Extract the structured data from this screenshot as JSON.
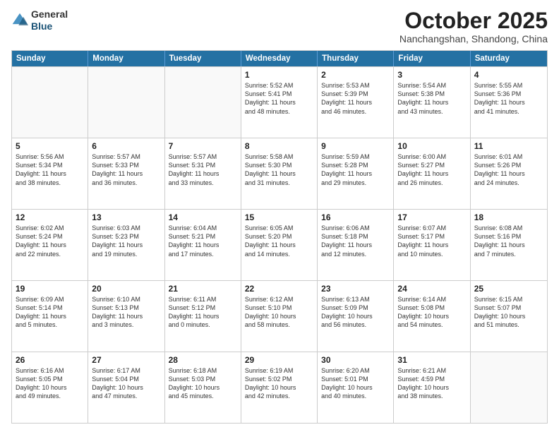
{
  "logo": {
    "general": "General",
    "blue": "Blue"
  },
  "header": {
    "month": "October 2025",
    "location": "Nanchangshan, Shandong, China"
  },
  "days": [
    "Sunday",
    "Monday",
    "Tuesday",
    "Wednesday",
    "Thursday",
    "Friday",
    "Saturday"
  ],
  "weeks": [
    [
      {
        "date": "",
        "info": ""
      },
      {
        "date": "",
        "info": ""
      },
      {
        "date": "",
        "info": ""
      },
      {
        "date": "1",
        "info": "Sunrise: 5:52 AM\nSunset: 5:41 PM\nDaylight: 11 hours\nand 48 minutes."
      },
      {
        "date": "2",
        "info": "Sunrise: 5:53 AM\nSunset: 5:39 PM\nDaylight: 11 hours\nand 46 minutes."
      },
      {
        "date": "3",
        "info": "Sunrise: 5:54 AM\nSunset: 5:38 PM\nDaylight: 11 hours\nand 43 minutes."
      },
      {
        "date": "4",
        "info": "Sunrise: 5:55 AM\nSunset: 5:36 PM\nDaylight: 11 hours\nand 41 minutes."
      }
    ],
    [
      {
        "date": "5",
        "info": "Sunrise: 5:56 AM\nSunset: 5:34 PM\nDaylight: 11 hours\nand 38 minutes."
      },
      {
        "date": "6",
        "info": "Sunrise: 5:57 AM\nSunset: 5:33 PM\nDaylight: 11 hours\nand 36 minutes."
      },
      {
        "date": "7",
        "info": "Sunrise: 5:57 AM\nSunset: 5:31 PM\nDaylight: 11 hours\nand 33 minutes."
      },
      {
        "date": "8",
        "info": "Sunrise: 5:58 AM\nSunset: 5:30 PM\nDaylight: 11 hours\nand 31 minutes."
      },
      {
        "date": "9",
        "info": "Sunrise: 5:59 AM\nSunset: 5:28 PM\nDaylight: 11 hours\nand 29 minutes."
      },
      {
        "date": "10",
        "info": "Sunrise: 6:00 AM\nSunset: 5:27 PM\nDaylight: 11 hours\nand 26 minutes."
      },
      {
        "date": "11",
        "info": "Sunrise: 6:01 AM\nSunset: 5:26 PM\nDaylight: 11 hours\nand 24 minutes."
      }
    ],
    [
      {
        "date": "12",
        "info": "Sunrise: 6:02 AM\nSunset: 5:24 PM\nDaylight: 11 hours\nand 22 minutes."
      },
      {
        "date": "13",
        "info": "Sunrise: 6:03 AM\nSunset: 5:23 PM\nDaylight: 11 hours\nand 19 minutes."
      },
      {
        "date": "14",
        "info": "Sunrise: 6:04 AM\nSunset: 5:21 PM\nDaylight: 11 hours\nand 17 minutes."
      },
      {
        "date": "15",
        "info": "Sunrise: 6:05 AM\nSunset: 5:20 PM\nDaylight: 11 hours\nand 14 minutes."
      },
      {
        "date": "16",
        "info": "Sunrise: 6:06 AM\nSunset: 5:18 PM\nDaylight: 11 hours\nand 12 minutes."
      },
      {
        "date": "17",
        "info": "Sunrise: 6:07 AM\nSunset: 5:17 PM\nDaylight: 11 hours\nand 10 minutes."
      },
      {
        "date": "18",
        "info": "Sunrise: 6:08 AM\nSunset: 5:16 PM\nDaylight: 11 hours\nand 7 minutes."
      }
    ],
    [
      {
        "date": "19",
        "info": "Sunrise: 6:09 AM\nSunset: 5:14 PM\nDaylight: 11 hours\nand 5 minutes."
      },
      {
        "date": "20",
        "info": "Sunrise: 6:10 AM\nSunset: 5:13 PM\nDaylight: 11 hours\nand 3 minutes."
      },
      {
        "date": "21",
        "info": "Sunrise: 6:11 AM\nSunset: 5:12 PM\nDaylight: 11 hours\nand 0 minutes."
      },
      {
        "date": "22",
        "info": "Sunrise: 6:12 AM\nSunset: 5:10 PM\nDaylight: 10 hours\nand 58 minutes."
      },
      {
        "date": "23",
        "info": "Sunrise: 6:13 AM\nSunset: 5:09 PM\nDaylight: 10 hours\nand 56 minutes."
      },
      {
        "date": "24",
        "info": "Sunrise: 6:14 AM\nSunset: 5:08 PM\nDaylight: 10 hours\nand 54 minutes."
      },
      {
        "date": "25",
        "info": "Sunrise: 6:15 AM\nSunset: 5:07 PM\nDaylight: 10 hours\nand 51 minutes."
      }
    ],
    [
      {
        "date": "26",
        "info": "Sunrise: 6:16 AM\nSunset: 5:05 PM\nDaylight: 10 hours\nand 49 minutes."
      },
      {
        "date": "27",
        "info": "Sunrise: 6:17 AM\nSunset: 5:04 PM\nDaylight: 10 hours\nand 47 minutes."
      },
      {
        "date": "28",
        "info": "Sunrise: 6:18 AM\nSunset: 5:03 PM\nDaylight: 10 hours\nand 45 minutes."
      },
      {
        "date": "29",
        "info": "Sunrise: 6:19 AM\nSunset: 5:02 PM\nDaylight: 10 hours\nand 42 minutes."
      },
      {
        "date": "30",
        "info": "Sunrise: 6:20 AM\nSunset: 5:01 PM\nDaylight: 10 hours\nand 40 minutes."
      },
      {
        "date": "31",
        "info": "Sunrise: 6:21 AM\nSunset: 4:59 PM\nDaylight: 10 hours\nand 38 minutes."
      },
      {
        "date": "",
        "info": ""
      }
    ]
  ]
}
